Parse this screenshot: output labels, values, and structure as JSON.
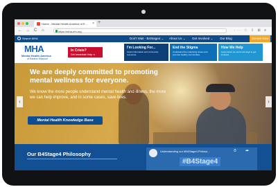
{
  "browser": {
    "tab_title": "Home - Mental Health America of E...",
    "tab_close": "×",
    "new_tab": "+",
    "url": "https://mha-em.org",
    "nav": {
      "back": "←",
      "forward": "→",
      "reload": "C",
      "home": "⌂"
    },
    "right_icons": "··· ☆ ⇩ ⊞ ≡"
  },
  "site_nav": {
    "search_label": "Search MHA",
    "items": [
      "Don't Wait - B4Stage4 ⌄",
      "About Us ⌄",
      "Get Involved ⌄",
      "Our Blog"
    ],
    "donate": "Donate Now"
  },
  "header": {
    "logo_text": "MHA",
    "logo_line1": "Mental Health America",
    "logo_line2": "of Eastern Missouri",
    "crisis_title": "In Crisis?",
    "crisis_sub": "Get Immediate Help ➔",
    "cards": [
      {
        "title": "I'm Looking For...",
        "sub": "Useful information and community resources.",
        "color": "#0d3f78"
      },
      {
        "title": "End the Stigma",
        "sub": "Understand the underlying issues and promote healthy communities.",
        "color": "#0f6fb6"
      },
      {
        "title": "How We Help",
        "sub": "Learn about our work and ways to get involved.",
        "color": "#2196d3"
      }
    ]
  },
  "hero": {
    "title": "We are deeply committed to promoting mental wellness for everyone.",
    "text": "We know the more people understand mental health and illness, the more we can help improve, and in some cases, save lives.",
    "button": "Mental Health Knowledge Base",
    "prev": "‹",
    "next": "›"
  },
  "bottom": {
    "philosophy_title": "Our B4Stage4 Philosophy",
    "video_title": "Understanding our #B4Stage4 Philoso...",
    "video_tag": "#B4Stage4",
    "video_icons": "⏱ ➦"
  },
  "colors": {
    "nav_bg": "#0f4a8a",
    "donate": "#f5a623",
    "crisis": "#c8102e",
    "hero_button": "#0e4d8f",
    "bottom_bg": "#124f93"
  }
}
